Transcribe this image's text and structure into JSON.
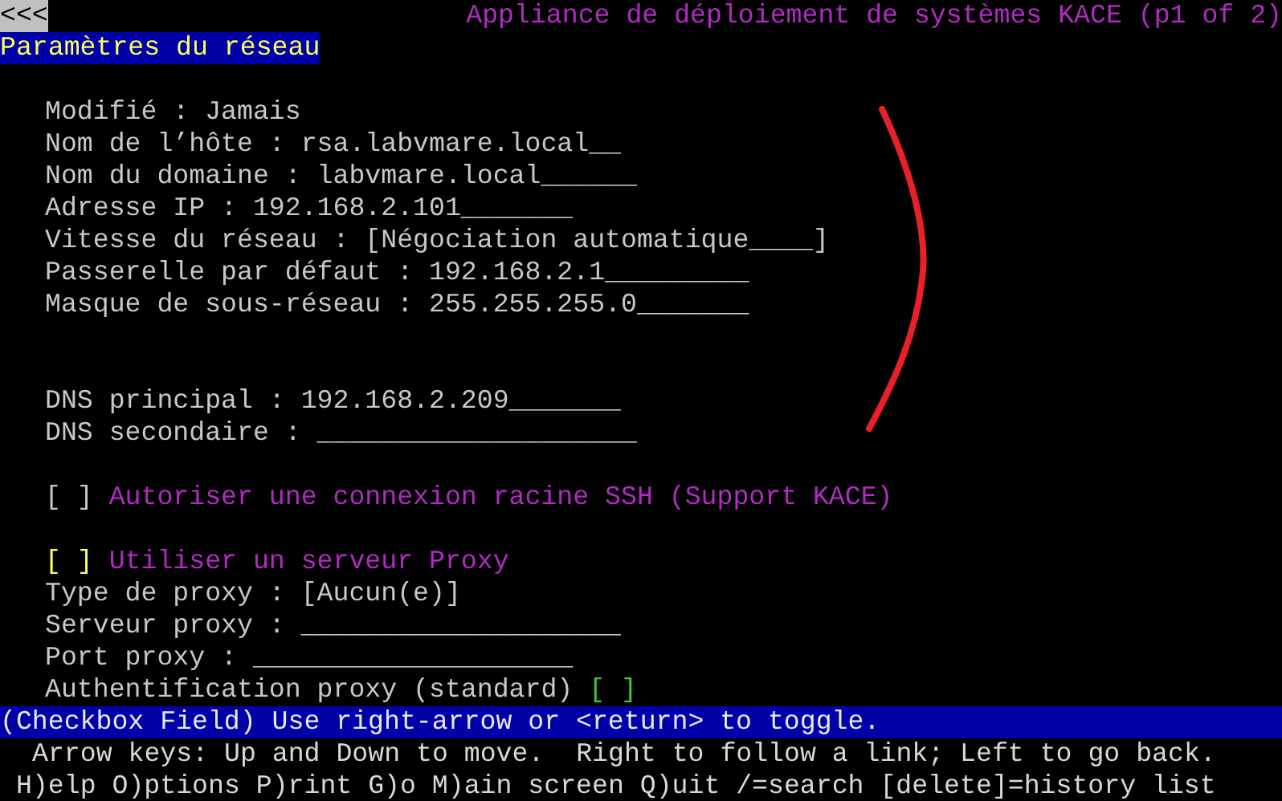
{
  "top_bar": {
    "back": "<<<",
    "title": "Appliance de déploiement de systèmes KACE (p1 of 2)"
  },
  "section_title": "Paramètres du réseau",
  "sections": [
    [
      {
        "kind": "field",
        "label": "Modifié :",
        "value": "Jamais"
      },
      {
        "kind": "field",
        "label": "Nom de l’hôte :",
        "value": "rsa.labvmare.local__"
      },
      {
        "kind": "field",
        "label": "Nom du domaine :",
        "value": "labvmare.local______"
      },
      {
        "kind": "field",
        "label": "Adresse IP :",
        "value": "192.168.2.101_______"
      },
      {
        "kind": "field",
        "label": "Vitesse du réseau :",
        "value": "[Négociation automatique____]"
      },
      {
        "kind": "field",
        "label": "Passerelle par défaut :",
        "value": "192.168.2.1_________"
      },
      {
        "kind": "field",
        "label": "Masque de sous-réseau :",
        "value": "255.255.255.0_______"
      }
    ],
    [
      {
        "kind": "field",
        "label": "DNS principal :",
        "value": "192.168.2.209_______"
      },
      {
        "kind": "field",
        "label": "DNS secondaire :",
        "value": "____________________"
      }
    ],
    [
      {
        "kind": "checkbox",
        "box": "[ ]",
        "label": "Autoriser une connexion racine SSH (Support KACE)",
        "checked": false,
        "focused": false
      }
    ],
    [
      {
        "kind": "checkbox",
        "box": "[ ]",
        "label": "Utiliser un serveur Proxy",
        "checked": false,
        "focused": true
      },
      {
        "kind": "field",
        "label": "Type de proxy :",
        "value": "[Aucun(e)]"
      },
      {
        "kind": "field",
        "label": "Serveur proxy :",
        "value": "____________________"
      },
      {
        "kind": "field",
        "label": "Port proxy :",
        "value": "____________________"
      },
      {
        "kind": "trailing_checkbox",
        "box": "[ ]",
        "label": "Authentification proxy (standard)",
        "checked": false,
        "focused": false
      }
    ]
  ],
  "status_bar": "(Checkbox Field) Use right-arrow or <return> to toggle.",
  "help_lines": [
    "Arrow keys: Up and Down to move.  Right to follow a link; Left to go back.",
    "H)elp O)ptions P)rint G)o M)ain screen Q)uit /=search [delete]=history list"
  ]
}
